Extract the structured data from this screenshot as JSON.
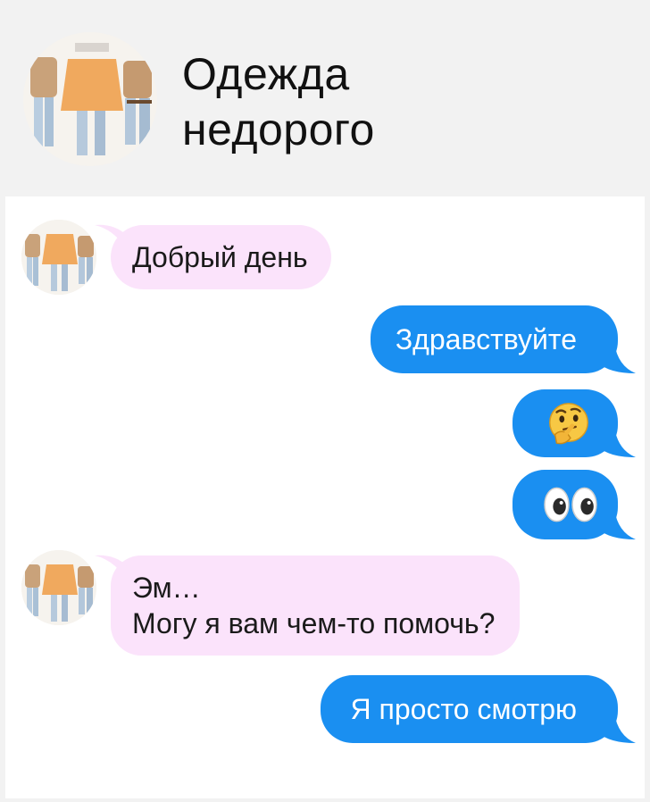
{
  "header": {
    "title_line1": "Одежда",
    "title_line2": "недорого",
    "avatar_icon": "clothing-store-avatar"
  },
  "messages": [
    {
      "direction": "incoming",
      "text": "Добрый день"
    },
    {
      "direction": "outgoing",
      "text": "Здравствуйте"
    },
    {
      "direction": "outgoing",
      "emoji": "thinking-face-icon"
    },
    {
      "direction": "outgoing",
      "emoji": "eyes-icon"
    },
    {
      "direction": "incoming",
      "line1": "Эм…",
      "line2": "Могу я вам чем-то помочь?"
    },
    {
      "direction": "outgoing",
      "text": "Я просто смотрю"
    }
  ],
  "colors": {
    "header_bg": "#f2f2f2",
    "chat_bg": "#ffffff",
    "incoming_bubble": "#fbe3fb",
    "outgoing_bubble": "#1a8ff1"
  }
}
